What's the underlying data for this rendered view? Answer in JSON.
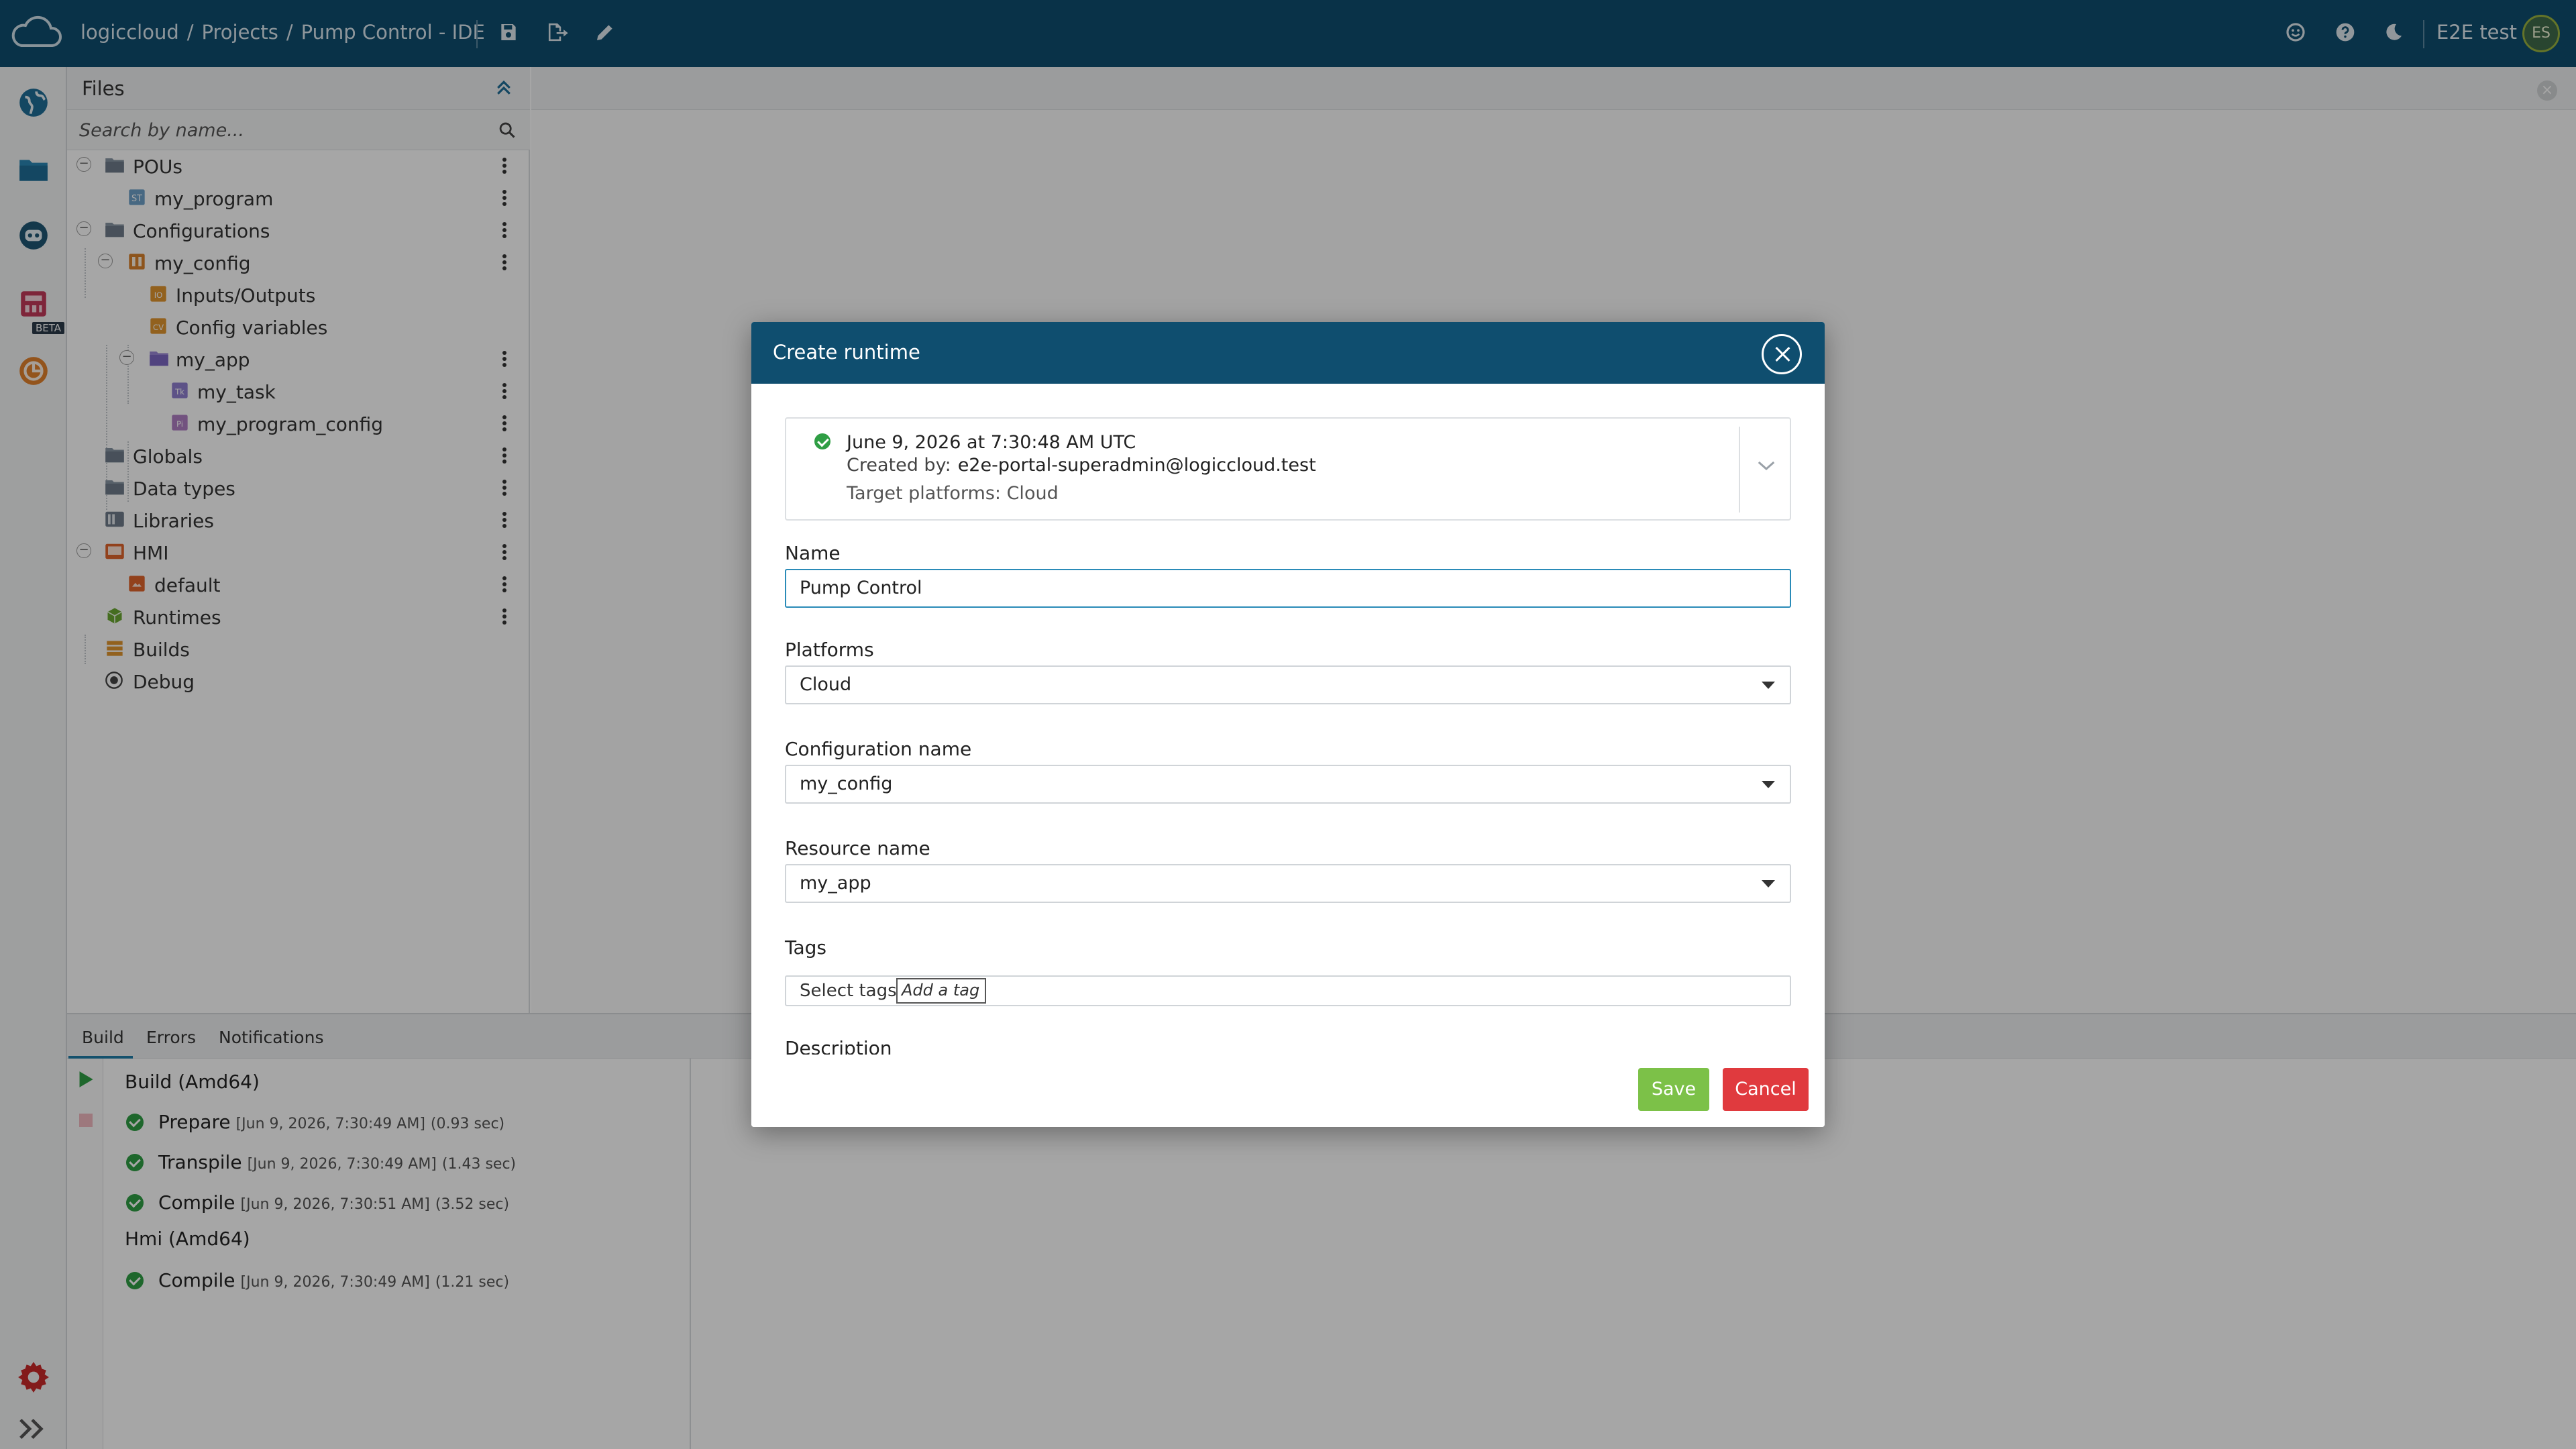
{
  "header": {
    "breadcrumbs": [
      "logiccloud",
      "Projects",
      "Pump Control - IDE"
    ],
    "user_name": "E2E test",
    "avatar_initials": "ES",
    "brand_color": "#0f4e6f",
    "icons": [
      "cloud-logo-icon",
      "save-icon",
      "export-icon",
      "edit-icon",
      "smiley-icon",
      "help-icon",
      "moon-icon"
    ]
  },
  "rail": {
    "items": [
      "globe-icon",
      "folder-icon",
      "robot-icon",
      "plc-device-icon",
      "runtime-badge-icon"
    ],
    "beta_label": "BETA",
    "bottom": [
      "settings-gear-icon",
      "expand-rail-icon"
    ]
  },
  "files": {
    "title": "Files",
    "search_placeholder": "Search by name...",
    "tree": [
      {
        "label": "POUs"
      },
      {
        "label": "my_program"
      },
      {
        "label": "Configurations"
      },
      {
        "label": "my_config"
      },
      {
        "label": "Inputs/Outputs"
      },
      {
        "label": "Config variables"
      },
      {
        "label": "my_app"
      },
      {
        "label": "my_task"
      },
      {
        "label": "my_program_config"
      },
      {
        "label": "Globals"
      },
      {
        "label": "Data types"
      },
      {
        "label": "Libraries"
      },
      {
        "label": "HMI"
      },
      {
        "label": "default"
      },
      {
        "label": "Runtimes"
      },
      {
        "label": "Builds"
      },
      {
        "label": "Debug"
      }
    ]
  },
  "bottom_panel": {
    "tabs": [
      "Build",
      "Errors",
      "Notifications"
    ],
    "active_tab": "Build",
    "groups": [
      {
        "title": "Build (Amd64)",
        "steps": [
          {
            "name": "Prepare",
            "time": "[Jun 9, 2026, 7:30:49 AM]",
            "duration": "(0.93 sec)"
          },
          {
            "name": "Transpile",
            "time": "[Jun 9, 2026, 7:30:49 AM]",
            "duration": "(1.43 sec)"
          },
          {
            "name": "Compile",
            "time": "[Jun 9, 2026, 7:30:51 AM]",
            "duration": "(3.52 sec)"
          }
        ]
      },
      {
        "title": "Hmi (Amd64)",
        "steps": [
          {
            "name": "Compile",
            "time": "[Jun 9, 2026, 7:30:49 AM]",
            "duration": "(1.21 sec)"
          }
        ]
      }
    ]
  },
  "dialog": {
    "title": "Create runtime",
    "version": {
      "date": "June 9, 2026 at 7:30:48 AM UTC",
      "created_by_label": "Created by:",
      "created_by": "e2e-portal-superadmin@logiccloud.test",
      "target_platforms": "Target platforms: Cloud"
    },
    "fields": {
      "name_label": "Name",
      "name_value": "Pump Control",
      "platforms_label": "Platforms",
      "platforms_value": "Cloud",
      "config_label": "Configuration name",
      "config_value": "my_config",
      "resource_label": "Resource name",
      "resource_value": "my_app",
      "tags_label": "Tags",
      "tags_select": "Select tags",
      "tags_add_placeholder": "Add a tag",
      "description_label": "Description"
    },
    "save_label": "Save",
    "cancel_label": "Cancel",
    "colors": {
      "save": "#7cc148",
      "cancel": "#e03a3e",
      "focus": "#2a8bb8"
    }
  }
}
